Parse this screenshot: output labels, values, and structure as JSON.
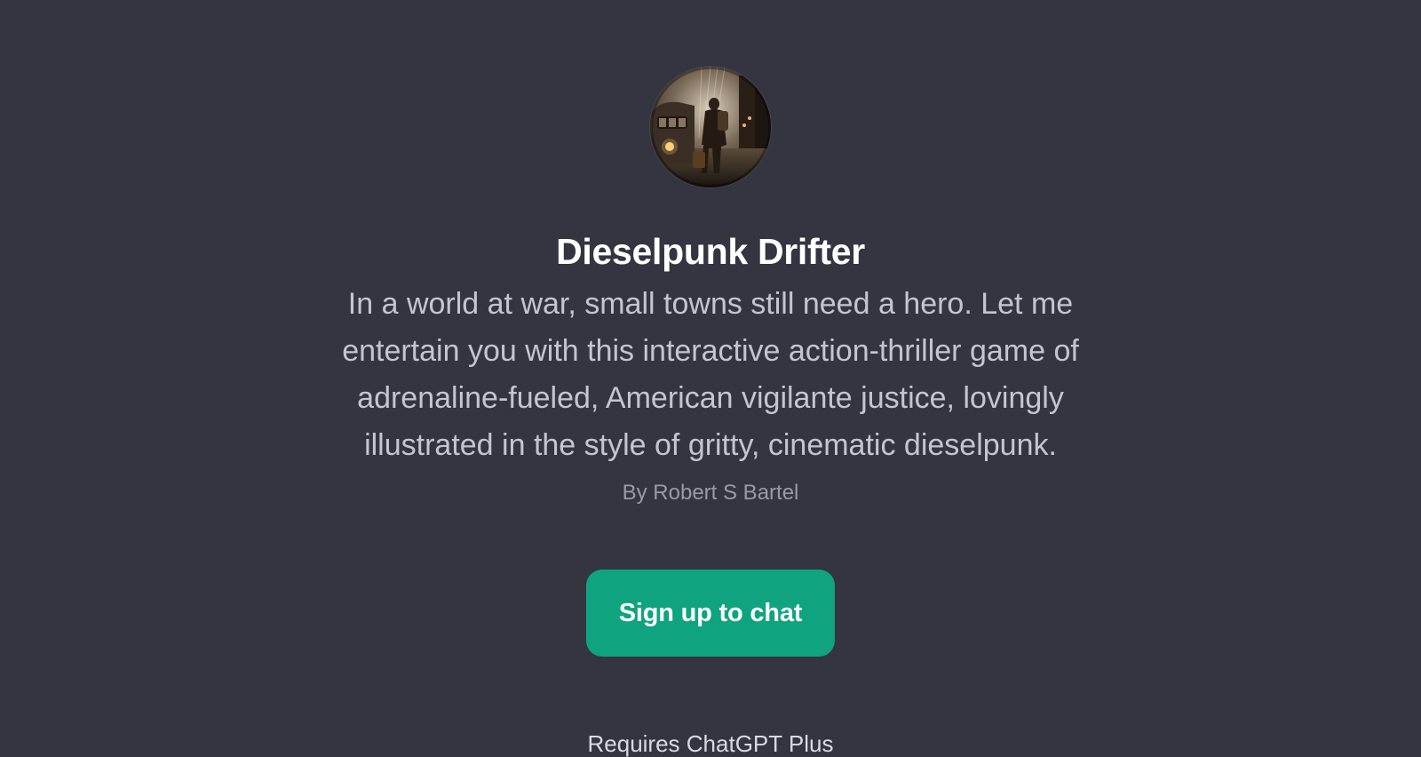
{
  "gpt": {
    "name": "Dieselpunk Drifter",
    "description": "In a world at war, small towns still need a hero. Let me entertain you with this interactive action-thriller game of adrenaline-fueled, American vigilante justice, lovingly illustrated in the style of gritty, cinematic dieselpunk.",
    "author": "By Robert S Bartel",
    "avatar_icon": "dieselpunk-drifter-avatar"
  },
  "actions": {
    "signup_label": "Sign up to chat"
  },
  "footer": {
    "text": "Requires ChatGPT Plus"
  },
  "colors": {
    "background": "#343541",
    "accent": "#10a37f"
  }
}
